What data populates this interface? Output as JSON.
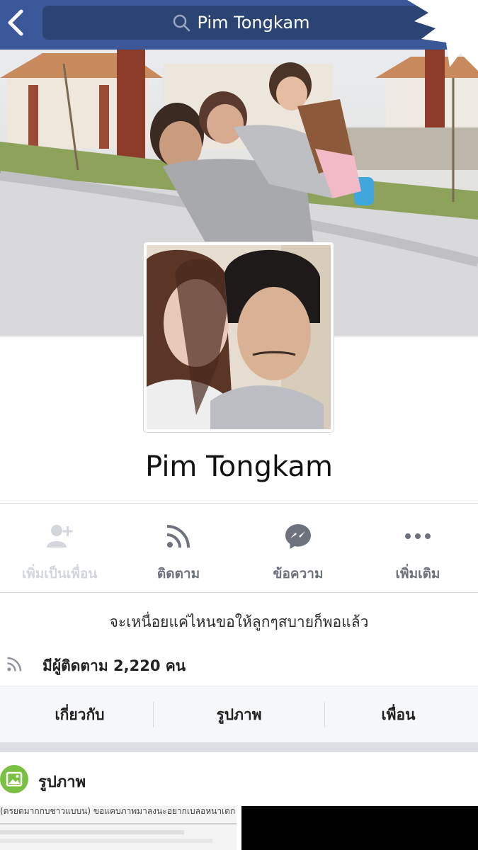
{
  "header": {
    "search_text": "Pim Tongkam",
    "bar_color": "#3b5998"
  },
  "profile": {
    "name": "Pim Tongkam",
    "bio": "จะเหนื่อยแค่ไหนขอให้ลูกๆสบายก็พอแล้ว",
    "followers_text": "มีผู้ติดตาม 2,220 คน"
  },
  "actions": [
    {
      "label": "เพิ่มเป็นเพื่อน",
      "icon": "add-friend-icon",
      "enabled": false
    },
    {
      "label": "ติดตาม",
      "icon": "rss-follow-icon",
      "enabled": true
    },
    {
      "label": "ข้อความ",
      "icon": "messenger-icon",
      "enabled": true
    },
    {
      "label": "เพิ่มเติม",
      "icon": "more-dots-icon",
      "enabled": true
    }
  ],
  "tabs": [
    {
      "label": "เกี่ยวกับ"
    },
    {
      "label": "รูปภาพ"
    },
    {
      "label": "เพื่อน"
    }
  ],
  "photos_section": {
    "title": "รูปภาพ",
    "thumb1_text": "(ตรยดมากกบชาวแบบน) ขอแคบภาพมาลงนะอยากเบลอหนาเดก"
  }
}
